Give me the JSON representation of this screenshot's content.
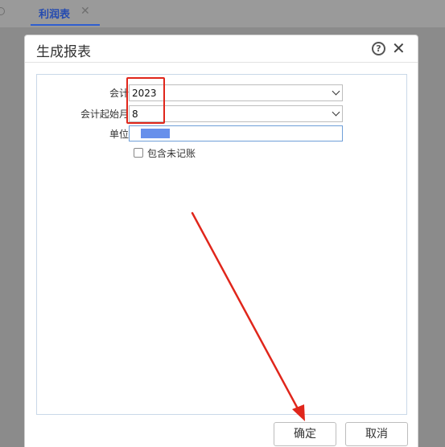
{
  "tabbar": {
    "active_tab_label": "利润表",
    "close_glyph": "✕"
  },
  "dialog": {
    "title": "生成报表",
    "help_glyph": "?",
    "close_glyph": "✕"
  },
  "form": {
    "fiscal_year": {
      "label": "会计年",
      "value": "2023"
    },
    "start_month": {
      "label": "会计起始月",
      "value": "8"
    },
    "unit": {
      "label": "单位",
      "value": ""
    },
    "include_unposted": {
      "label": "包含未记账",
      "checked": false
    }
  },
  "buttons": {
    "confirm": "确定",
    "cancel": "取消"
  },
  "annotation": {
    "highlight_color": "#e0261b",
    "arrow_color": "#e0261b"
  }
}
